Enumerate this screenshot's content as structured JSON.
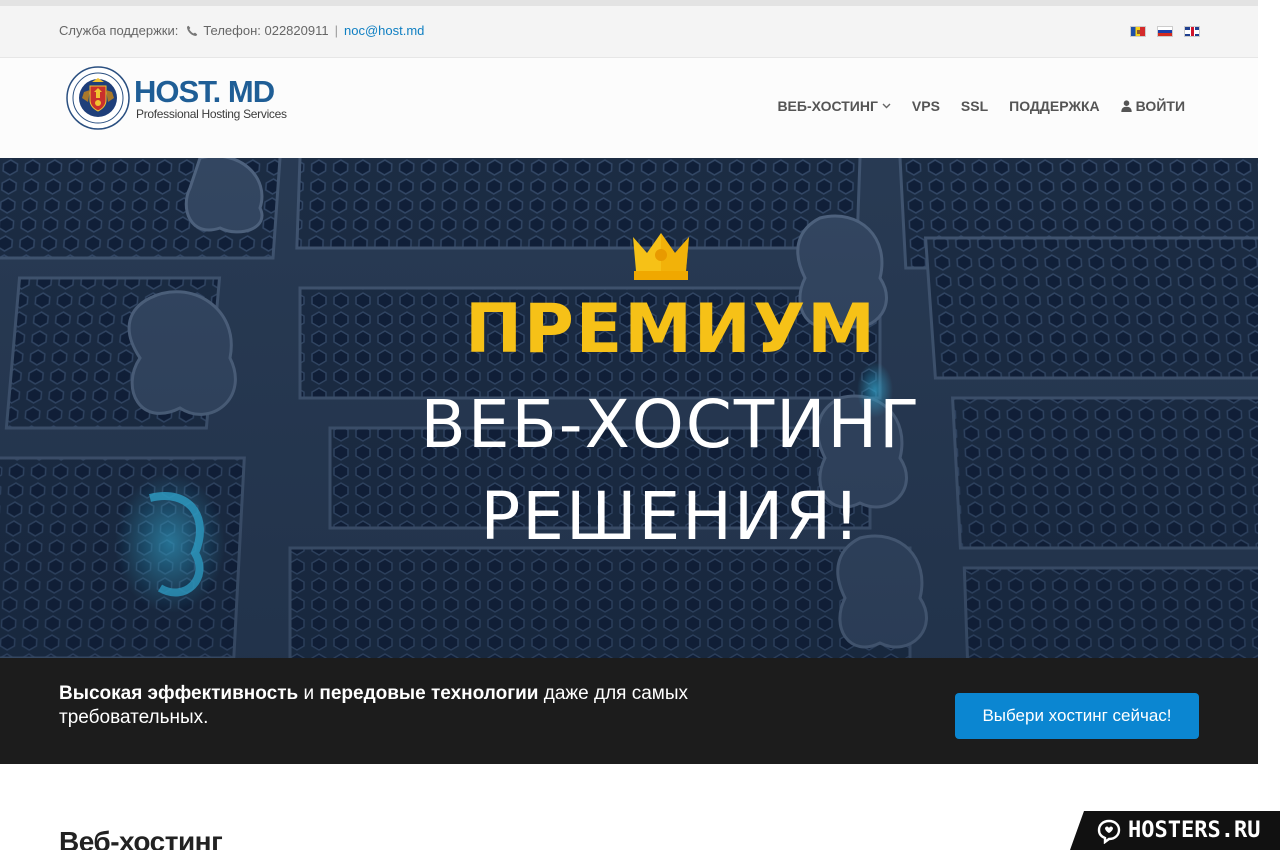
{
  "topbar": {
    "support_label": "Служба поддержки:",
    "phone_label": "Телефон: 022820911",
    "separator": "|",
    "email": "noc@host.md",
    "languages": [
      {
        "code": "md"
      },
      {
        "code": "ru"
      },
      {
        "code": "en"
      }
    ]
  },
  "logo": {
    "main": "HOST. MD",
    "sub": "Professional Hosting Services"
  },
  "nav": {
    "items": [
      {
        "label": "ВЕБ-ХОСТИНГ",
        "has_dropdown": true
      },
      {
        "label": "VPS"
      },
      {
        "label": "SSL"
      },
      {
        "label": "ПОДДЕРЖКА"
      },
      {
        "label": "ВОЙТИ",
        "icon": "user-icon"
      }
    ]
  },
  "hero": {
    "icon": "crown-icon",
    "premium": "ПРЕМИУМ",
    "line1": "ВЕБ-ХОСТИНГ",
    "line2": "РЕШЕНИЯ!"
  },
  "cta": {
    "bold1": "Высокая эффективность",
    "text1": " и ",
    "bold2": "передовые технологии",
    "text2": " даже для самых требовательных.",
    "button": "Выбери хостинг сейчас!"
  },
  "section": {
    "title": "Веб-хостинг"
  },
  "watermark": {
    "text": "HOSTERS.RU"
  },
  "colors": {
    "accent": "#0b86d1",
    "premium": "#f6c117",
    "logo_blue": "#1f5e96",
    "dark_strip": "#1c1c1c",
    "hero_bg": "#2a3d57"
  }
}
